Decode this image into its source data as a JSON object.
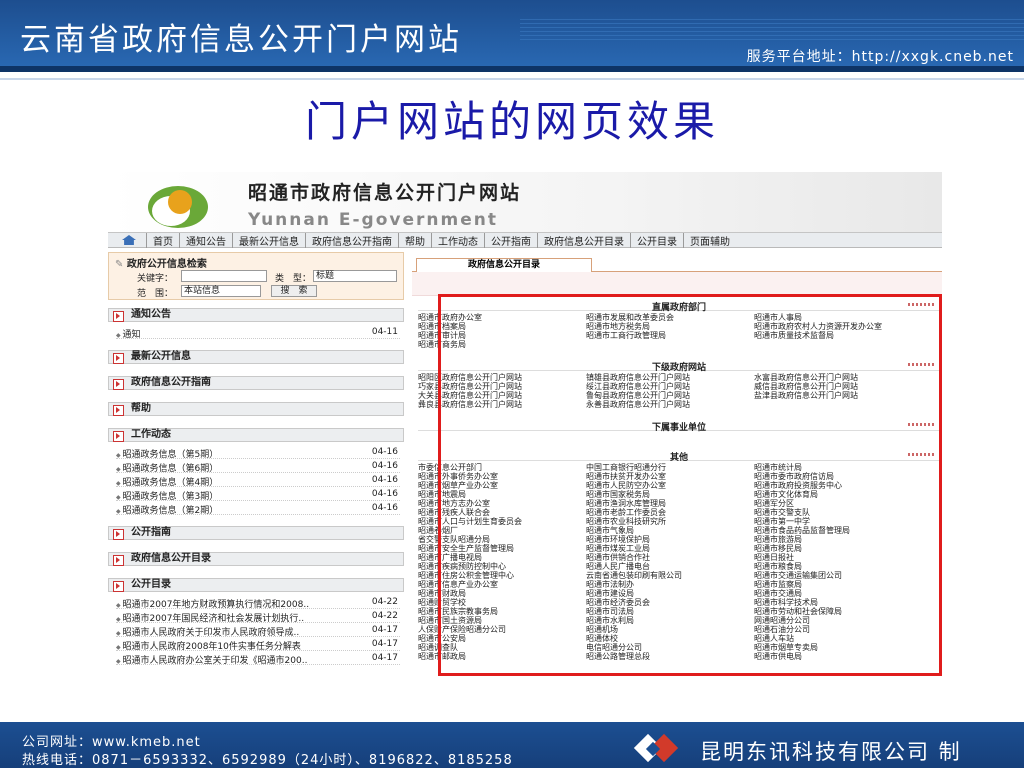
{
  "header": {
    "title": "云南省政府信息公开门户网站",
    "service_url": "服务平台地址：http://xxgk.cneb.net"
  },
  "slide_title": "门户网站的网页效果",
  "site": {
    "name_cn": "昭通市政府信息公开门户网站",
    "name_en": "Yunnan E-government",
    "nav": [
      "首页",
      "通知公告",
      "最新公开信息",
      "政府信息公开指南",
      "帮助",
      "工作动态",
      "公开指南",
      "政府信息公开目录",
      "公开目录",
      "页面辅助"
    ]
  },
  "search": {
    "title": "政府公开信息检索",
    "keyword_label": "关键字：",
    "type_label": "类　型：",
    "type_value": "标题",
    "scope_label": "范　围：",
    "scope_value": "本站信息",
    "button": "搜　索"
  },
  "sections": {
    "notice": "通知公告",
    "latest": "最新公开信息",
    "guide": "政府信息公开指南",
    "help": "帮助",
    "work": "工作动态",
    "public_guide": "公开指南",
    "catalog": "政府信息公开目录",
    "open_catalog": "公开目录"
  },
  "notice_items": [
    {
      "title": "通知",
      "date": "04-11"
    }
  ],
  "work_items": [
    {
      "title": "昭通政务信息（第5期）",
      "date": "04-16"
    },
    {
      "title": "昭通政务信息（第6期）",
      "date": "04-16"
    },
    {
      "title": "昭通政务信息（第4期）",
      "date": "04-16"
    },
    {
      "title": "昭通政务信息（第3期）",
      "date": "04-16"
    },
    {
      "title": "昭通政务信息（第2期）",
      "date": "04-16"
    }
  ],
  "catalog_items": [
    {
      "title": "昭通市2007年地方财政预算执行情况和2008..",
      "date": "04-22"
    },
    {
      "title": "昭通市2007年国民经济和社会发展计划执行..",
      "date": "04-22"
    },
    {
      "title": "昭通市人民政府关于印发市人民政府领导成..",
      "date": "04-17"
    },
    {
      "title": "昭通市人民政府2008年10件实事任务分解表",
      "date": "04-17"
    },
    {
      "title": "昭通市人民政府办公室关于印发《昭通市200..",
      "date": "04-17"
    }
  ],
  "right": {
    "tab": "政府信息公开目录",
    "groups": [
      {
        "title": "直属政府部门",
        "items": [
          "昭通市政府办公室",
          "昭通市发展和改革委员会",
          "昭通市人事局",
          "昭通市档案局",
          "昭通市地方税务局",
          "昭通市政府农村人力资源开发办公室",
          "昭通市审计局",
          "昭通市工商行政管理局",
          "昭通市质量技术监督局",
          "昭通市商务局"
        ]
      },
      {
        "title": "下级政府网站",
        "items": [
          "昭阳区政府信息公开门户网站",
          "镇雄县政府信息公开门户网站",
          "水富县政府信息公开门户网站",
          "巧家县政府信息公开门户网站",
          "绥江县政府信息公开门户网站",
          "威信县政府信息公开门户网站",
          "大关县政府信息公开门户网站",
          "鲁甸县政府信息公开门户网站",
          "盐津县政府信息公开门户网站",
          "彝良县政府信息公开门户网站",
          "永善县政府信息公开门户网站"
        ]
      },
      {
        "title": "下属事业单位",
        "items": []
      },
      {
        "title": "其他",
        "items": [
          "市委信息公开部门",
          "中国工商银行昭通分行",
          "昭通市统计局",
          "昭通市外事侨务办公室",
          "昭通市扶贫开发办公室",
          "昭通市委市政府信访局",
          "昭通市烟草产业办公室",
          "昭通市人民防空办公室",
          "昭通市政府投资服务中心",
          "昭通市地震局",
          "昭通市国家税务局",
          "昭通市文化体育局",
          "昭通市地方志办公室",
          "昭通市渔洞水库管理局",
          "昭通军分区",
          "昭通市残疾人联合会",
          "昭通市老龄工作委员会",
          "昭通市交警支队",
          "昭通市人口与计划生育委员会",
          "昭通市农业科技研究所",
          "昭通市第一中学",
          "昭通卷烟厂",
          "昭通市气象局",
          "昭通市食品药品监督管理局",
          "省交警支队昭通分局",
          "昭通市环境保护局",
          "昭通市旅游局",
          "昭通市安全生产监督管理局",
          "昭通市煤炭工业局",
          "昭通市移民局",
          "昭通市广播电视局",
          "昭通市供销合作社",
          "昭通日报社",
          "昭通市疾病预防控制中心",
          "昭通人民广播电台",
          "昭通市粮食局",
          "昭通市住房公积金管理中心",
          "云南省通包装印刷有限公司",
          "昭通市交通运输集团公司",
          "昭通市信息产业办公室",
          "昭通市法制办",
          "昭通市监察局",
          "昭通市财政局",
          "昭通市建设局",
          "昭通市交通局",
          "昭通财贸学校",
          "昭通市经济委员会",
          "昭通市科学技术局",
          "昭通市民族宗教事务局",
          "昭通市司法局",
          "昭通市劳动和社会保障局",
          "昭通市国土资源局",
          "昭通市水利局",
          "网通昭通分公司",
          "人保财产保险昭通分公司",
          "昭通机场",
          "昭通石油分公司",
          "昭通市公安局",
          "昭通体校",
          "昭通人车站",
          "昭通调查队",
          "电信昭通分公司",
          "昭通市烟草专卖局",
          "昭通市邮政局",
          "昭通公路管理总段",
          "昭通市供电局"
        ]
      }
    ]
  },
  "footer": {
    "url_line": "公司网址：www.kmeb.net",
    "phone_line": "热线电话：0871－6593332、6592989（24小时）、8196822、8185258",
    "company": "昆明东讯科技有限公司 制"
  }
}
